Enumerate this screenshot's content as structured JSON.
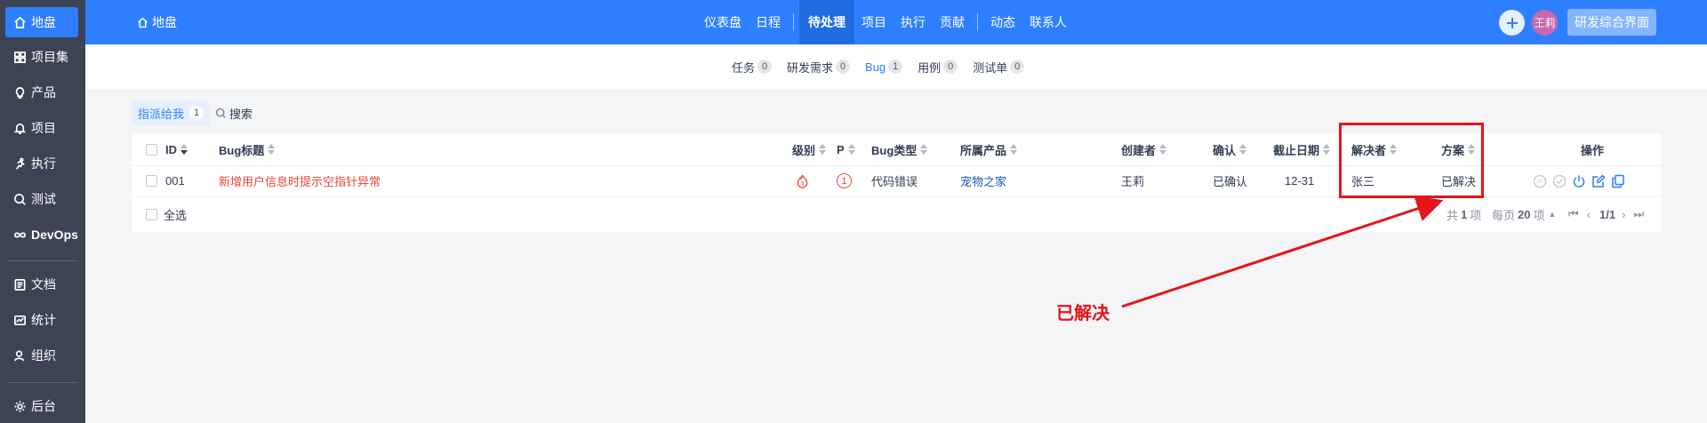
{
  "sidebar": {
    "items": [
      {
        "label": "地盘",
        "icon": "home-icon",
        "active": true
      },
      {
        "label": "项目集",
        "icon": "grid-icon"
      },
      {
        "label": "产品",
        "icon": "lightbulb-icon"
      },
      {
        "label": "项目",
        "icon": "bell-icon"
      },
      {
        "label": "执行",
        "icon": "run-icon"
      },
      {
        "label": "测试",
        "icon": "search-circle-icon"
      },
      {
        "label": "DevOps",
        "icon": "infinity-icon"
      },
      {
        "label": "文档",
        "icon": "doc-icon"
      },
      {
        "label": "统计",
        "icon": "chart-icon"
      },
      {
        "label": "组织",
        "icon": "user-icon"
      },
      {
        "label": "后台",
        "icon": "gear-icon"
      }
    ]
  },
  "header": {
    "title": "地盘",
    "nav": [
      "仪表盘",
      "日程",
      "待处理",
      "项目",
      "执行",
      "贡献",
      "动态",
      "联系人"
    ],
    "active_nav": "待处理",
    "avatar_text": "王莉",
    "mode_button": "研发综合界面",
    "accent": "#2e7fff"
  },
  "subnav": {
    "items": [
      {
        "label": "任务",
        "count": "0"
      },
      {
        "label": "研发需求",
        "count": "0"
      },
      {
        "label": "Bug",
        "count": "1",
        "active": true
      },
      {
        "label": "用例",
        "count": "0"
      },
      {
        "label": "测试单",
        "count": "0"
      }
    ]
  },
  "toolbar": {
    "feature_tab": "指派给我",
    "feature_count": "1",
    "search_label": "搜索"
  },
  "table": {
    "columns": [
      "ID",
      "Bug标题",
      "级别",
      "P",
      "Bug类型",
      "所属产品",
      "创建者",
      "确认",
      "截止日期",
      "解决者",
      "方案",
      "操作"
    ],
    "rows": [
      {
        "id": "001",
        "title": "新增用户信息时提示空指针异常",
        "severity": "3",
        "priority": "1",
        "type": "代码错误",
        "product": "宠物之家",
        "creator": "王莉",
        "confirmed": "已确认",
        "deadline": "12-31",
        "resolver": "张三",
        "resolution": "已解决"
      }
    ],
    "select_all": "全选",
    "pager": {
      "total_prefix": "共",
      "total": "1",
      "total_suffix": "项",
      "per_page_prefix": "每页",
      "per_page": "20",
      "per_page_suffix": "项",
      "page": "1/1"
    }
  },
  "annotation": {
    "callout_text": "已解决",
    "color": "#e5141d"
  }
}
